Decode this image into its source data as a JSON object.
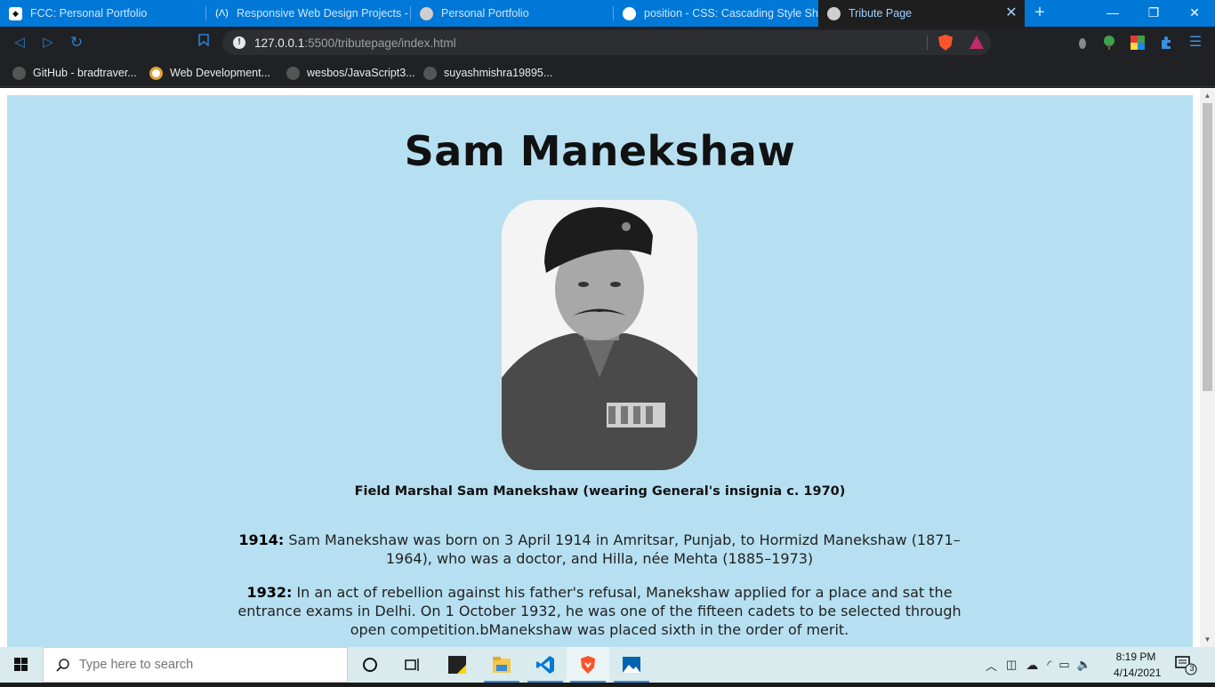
{
  "browser": {
    "tabs": [
      {
        "title": "FCC: Personal Portfolio",
        "active": false
      },
      {
        "title": "Responsive Web Design Projects - B",
        "active": false
      },
      {
        "title": "Personal Portfolio",
        "active": false
      },
      {
        "title": "position - CSS: Cascading Style Shee",
        "active": false
      },
      {
        "title": "Tribute Page",
        "active": true
      }
    ],
    "url": {
      "host": "127.0.0.1",
      "path": ":5500/tributepage/index.html"
    },
    "bookmarks": [
      "GitHub - bradtraver...",
      "Web Development...",
      "wesbos/JavaScript3...",
      "suyashmishra19895..."
    ],
    "colors": {
      "tabstrip": "#0078d7",
      "toolbar": "#202124",
      "accent": "#2b7fd4"
    }
  },
  "page": {
    "title": "Sam Manekshaw",
    "image_caption": "Field Marshal Sam Manekshaw (wearing General's insignia c. 1970)",
    "timeline": [
      {
        "year": "1914:",
        "text": " Sam Manekshaw was born on 3 April 1914 in Amritsar, Punjab, to Hormizd Manekshaw (1871–1964), who was a doctor, and Hilla, née Mehta (1885–1973)"
      },
      {
        "year": "1932:",
        "text": " In an act of rebellion against his father's refusal, Manekshaw applied for a place and sat the entrance exams in Delhi. On 1 October 1932, he was one of the fifteen cadets to be selected through open competition.bManekshaw was placed sixth in the order of merit."
      }
    ],
    "background": "#b6e0f1"
  },
  "taskbar": {
    "search_placeholder": "Type here to search",
    "time": "8:19 PM",
    "date": "4/14/2021",
    "notification_count": "3"
  }
}
